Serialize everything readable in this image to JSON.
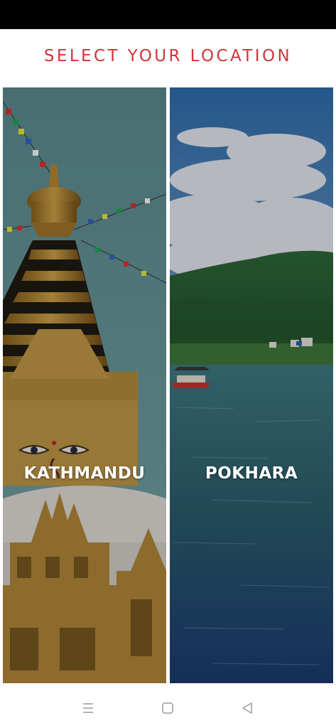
{
  "header": {
    "title": "SELECT YOUR LOCATION"
  },
  "locations": [
    {
      "label": "KATHMANDU"
    },
    {
      "label": "POKHARA"
    }
  ],
  "nav_bar": {
    "menu_icon": "menu-icon",
    "home_icon": "home-icon",
    "back_icon": "back-icon"
  },
  "colors": {
    "title": "#d0343a",
    "status_bar": "#000000"
  }
}
